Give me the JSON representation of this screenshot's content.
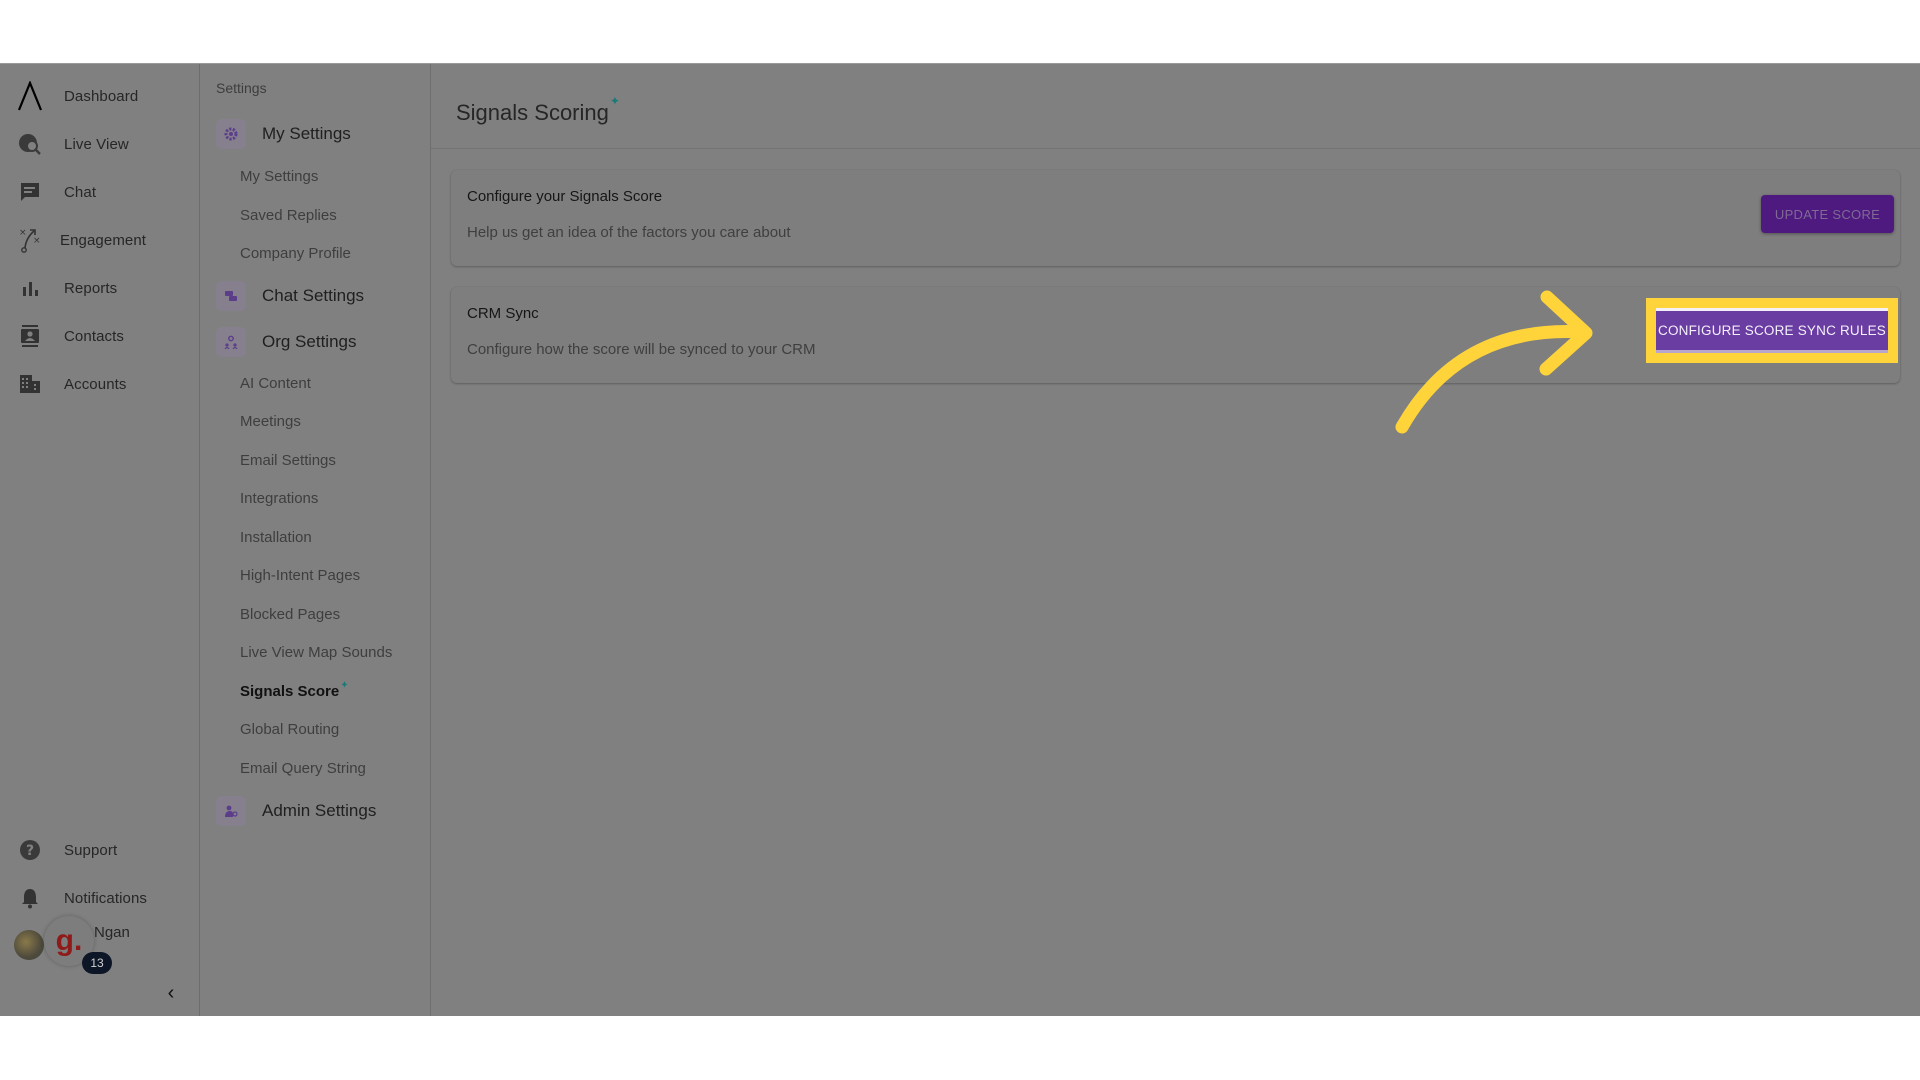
{
  "rail": {
    "items": [
      {
        "label": "Dashboard",
        "icon": "logo-icon"
      },
      {
        "label": "Live View",
        "icon": "globe-search-icon"
      },
      {
        "label": "Chat",
        "icon": "chat-icon"
      },
      {
        "label": "Engagement",
        "icon": "engagement-icon"
      },
      {
        "label": "Reports",
        "icon": "bar-chart-icon"
      },
      {
        "label": "Contacts",
        "icon": "contact-card-icon"
      },
      {
        "label": "Accounts",
        "icon": "building-icon"
      }
    ],
    "bottom": [
      {
        "label": "Support",
        "icon": "help-icon"
      },
      {
        "label": "Notifications",
        "icon": "bell-icon"
      }
    ],
    "user": {
      "name": "Ngan",
      "avatar_letter": "g.",
      "badge_count": "13"
    },
    "collapse_glyph": "‹"
  },
  "settings_nav": {
    "title": "Settings",
    "groups": [
      {
        "label": "My Settings",
        "icon": "gear-icon",
        "items": [
          "My Settings",
          "Saved Replies",
          "Company Profile"
        ]
      },
      {
        "label": "Chat Settings",
        "icon": "chat-bubbles-icon",
        "items": []
      },
      {
        "label": "Org Settings",
        "icon": "org-icon",
        "items": [
          "AI Content",
          "Meetings",
          "Email Settings",
          "Integrations",
          "Installation",
          "High-Intent Pages",
          "Blocked Pages",
          "Live View Map Sounds",
          "Signals Score",
          "Global Routing",
          "Email Query String"
        ]
      },
      {
        "label": "Admin Settings",
        "icon": "admin-icon",
        "items": []
      }
    ],
    "active_item": "Signals Score",
    "sparkle": "✦"
  },
  "main": {
    "title": "Signals Scoring",
    "title_sparkle": "✦",
    "cards": [
      {
        "title": "Configure your Signals Score",
        "description": "Help us get an idea of the factors you care about",
        "button": "UPDATE SCORE"
      },
      {
        "title": "CRM Sync",
        "description": "Configure how the score will be synced to your CRM",
        "button": "CONFIGURE SCORE SYNC RULES"
      }
    ]
  },
  "annotation": {
    "highlight_color": "#ffd43b",
    "target": "CONFIGURE SCORE SYNC RULES"
  },
  "colors": {
    "overlay_bg": "#808080",
    "primary_purple": "#6a3da3",
    "dim_purple": "#4e1a7f",
    "sparkle_teal": "#1a7a78"
  }
}
